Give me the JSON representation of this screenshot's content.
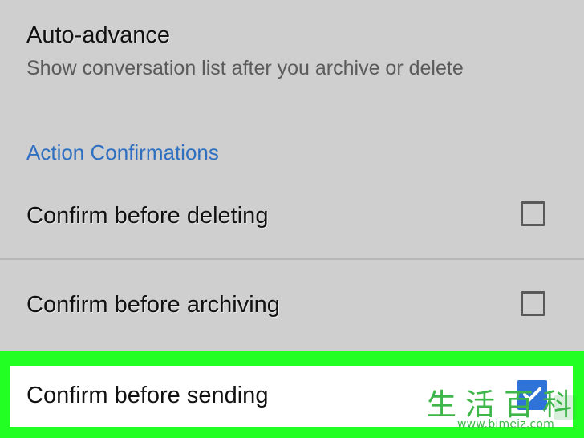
{
  "settings": {
    "auto_advance": {
      "title": "Auto-advance",
      "subtitle": "Show conversation list after you archive or delete"
    },
    "action_confirmations": {
      "label": "Action Confirmations"
    },
    "confirm_delete": {
      "label": "Confirm before deleting",
      "checked": false
    },
    "confirm_archive": {
      "label": "Confirm before archiving",
      "checked": false
    },
    "confirm_send": {
      "label": "Confirm before sending",
      "checked": true
    }
  },
  "watermark": {
    "chinese": "生活百科",
    "url": "www.bimeiz.com"
  },
  "colors": {
    "background": "#cfcfcf",
    "section_label": "#2f6fc0",
    "highlight": "#22ff22",
    "checked_box": "#2f73d8",
    "watermark": "#3fb64a"
  },
  "icons": {
    "checkbox_unchecked": "checkbox-unchecked-icon",
    "checkbox_checked": "checkbox-checked-icon",
    "watermark_logo": "watermark-logo-icon"
  }
}
